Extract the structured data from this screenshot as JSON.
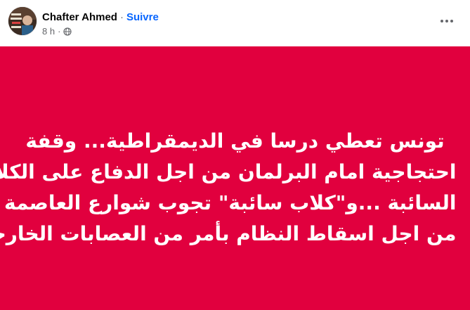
{
  "post": {
    "author": "Chafter Ahmed",
    "separator": "·",
    "follow_label": "Suivre",
    "time": "8 h",
    "time_separator": "·",
    "audience_icon": "globe-icon",
    "more_icon": "more-options-icon",
    "avatar_alt": "profile-avatar"
  },
  "card": {
    "background": "#e1003e",
    "text_color": "#ffffff",
    "lines": [
      "تونس تعطي درسا في الديمقراطية... وقفة",
      "احتجاجية امام البرلمان من اجل الدفاع على الكلاب",
      "السائبة ...و\"كلاب سائبة\" تجوب شوارع العاصمة",
      "من اجل اسقاط النظام بأمر من العصابات الخارجية"
    ]
  },
  "colors": {
    "link": "#0866ff",
    "secondary_text": "#65676b",
    "primary_text": "#050505"
  }
}
